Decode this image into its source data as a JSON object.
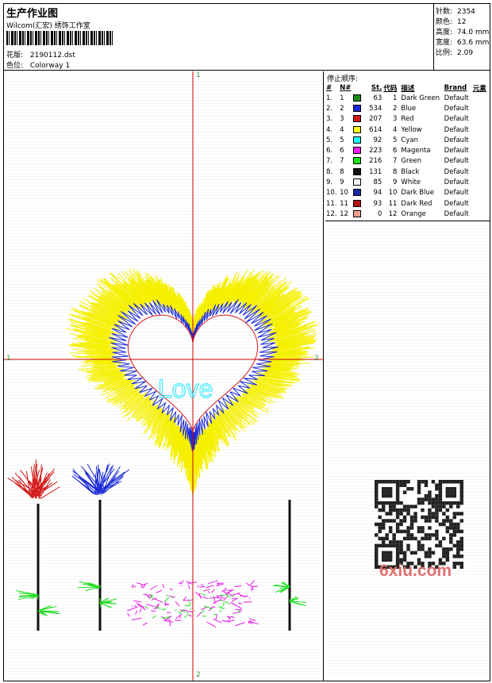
{
  "header": {
    "title": "生产作业图",
    "subtitle": "Wilcom(汇宏) 绣饰工作室",
    "design_label": "花版:",
    "design_value": "2190112.dst",
    "colorway_label": "色位:",
    "colorway_value": "Colorway 1"
  },
  "stats": [
    {
      "label": "针数:",
      "value": "2354"
    },
    {
      "label": "颜色:",
      "value": "12"
    },
    {
      "label": "高度:",
      "value": "74.0 mm"
    },
    {
      "label": "宽度:",
      "value": "63.6 mm"
    },
    {
      "label": "比例:",
      "value": "2.09"
    }
  ],
  "axes": {
    "top": "1",
    "bottom": "2",
    "left": "1",
    "right": "2"
  },
  "design_text": "Love",
  "sequence": {
    "title": "停止顺序:",
    "headers": [
      "#",
      "N#",
      "St.",
      "代码",
      "描述",
      "Brand",
      "元素"
    ],
    "rows": [
      {
        "idx": "1.",
        "n": "1",
        "color": "#1a8a1a",
        "st": "63",
        "code": "1",
        "desc": "Dark Green",
        "brand": "Default"
      },
      {
        "idx": "2.",
        "n": "2",
        "color": "#1c2bd6",
        "st": "534",
        "code": "2",
        "desc": "Blue",
        "brand": "Default"
      },
      {
        "idx": "3.",
        "n": "3",
        "color": "#d41a1a",
        "st": "207",
        "code": "3",
        "desc": "Red",
        "brand": "Default"
      },
      {
        "idx": "4.",
        "n": "4",
        "color": "#ffff1a",
        "st": "614",
        "code": "4",
        "desc": "Yellow",
        "brand": "Default"
      },
      {
        "idx": "5.",
        "n": "5",
        "color": "#1affff",
        "st": "92",
        "code": "5",
        "desc": "Cyan",
        "brand": "Default"
      },
      {
        "idx": "6.",
        "n": "6",
        "color": "#f01af0",
        "st": "223",
        "code": "6",
        "desc": "Magenta",
        "brand": "Default"
      },
      {
        "idx": "7.",
        "n": "7",
        "color": "#1ae61a",
        "st": "216",
        "code": "7",
        "desc": "Green",
        "brand": "Default"
      },
      {
        "idx": "8.",
        "n": "8",
        "color": "#111111",
        "st": "131",
        "code": "8",
        "desc": "Black",
        "brand": "Default"
      },
      {
        "idx": "9.",
        "n": "9",
        "color": "#f4f4f4",
        "st": "85",
        "code": "9",
        "desc": "White",
        "brand": "Default"
      },
      {
        "idx": "10.",
        "n": "10",
        "color": "#1a2aa8",
        "st": "94",
        "code": "10",
        "desc": "Dark Blue",
        "brand": "Default"
      },
      {
        "idx": "11.",
        "n": "11",
        "color": "#b01414",
        "st": "93",
        "code": "11",
        "desc": "Dark Red",
        "brand": "Default"
      },
      {
        "idx": "12.",
        "n": "12",
        "color": "#f0a090",
        "st": "0",
        "code": "12",
        "desc": "Orange",
        "brand": "Default"
      }
    ]
  },
  "watermark": "6xiu.com",
  "colors": {
    "axis": "#cc0000",
    "yellow": "#f5f000",
    "blue": "#1c2bd6",
    "red": "#d41a1a",
    "cyan": "#1ae6ff",
    "magenta": "#e61ae6",
    "green": "#22dd22",
    "black": "#111111"
  }
}
